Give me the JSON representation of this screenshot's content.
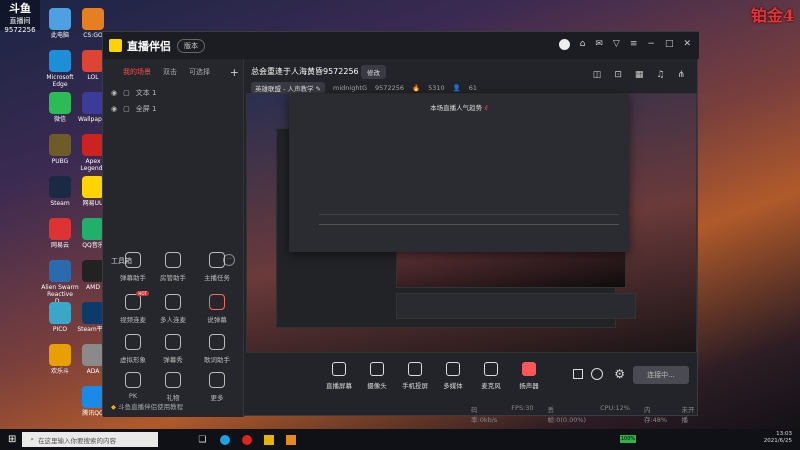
{
  "overlay": {
    "platform_logo": "斗鱼",
    "platform_sub": "直播间",
    "room_number": "9572256",
    "rank_badge": "铂金4"
  },
  "desktop": {
    "icons": [
      "此电脑",
      "Microsoft Edge",
      "微信",
      "PUBG",
      "Steam",
      "网易云",
      "Alien Swarm Reactive D...",
      "PICO",
      "欢乐斗",
      "CS:GO",
      "LOL",
      "Wallpaper",
      "Apex Legends",
      "网易UU",
      "QQ音乐",
      "AMD",
      "Steam平台",
      "ADA",
      "腾讯QQ"
    ]
  },
  "window": {
    "app_name": "直播伴侣",
    "app_tag": "版本",
    "left_tabs": [
      "我的场景",
      "双击",
      "可选择"
    ],
    "layers": [
      "文本 1",
      "全屏 1"
    ],
    "tools_header": "工具箱",
    "tools": [
      "弹幕助手",
      "房管助手",
      "主播任务",
      "视频连麦",
      "多人连麦",
      "说弹幕",
      "虚拟形象",
      "弹幕秀",
      "歌词助手",
      "PK",
      "礼物",
      "更多"
    ],
    "hot_tag": "HOT",
    "footer_tip": "斗鱼直播伴侣使用教程",
    "room_title": "总会重逢于人海黄昏9572256",
    "edit_label": "修改",
    "category": "英雄联盟 - 人声教学 ✎",
    "anchor": "midnightG",
    "room_id": "9572256",
    "fans": "5310",
    "online": "61",
    "popup_title": "本场直播人气趋势",
    "bottom_tools": [
      "直播屏幕",
      "摄像头",
      "手机投屏",
      "多媒体",
      "麦克风",
      "扬声器"
    ],
    "start_label": "连接中...",
    "stats": [
      "码率:0kb/s",
      "FPS:30",
      "丢帧:0(0.00%)",
      "CPU:12%",
      "内存:48%",
      "未开播"
    ]
  },
  "taskbar": {
    "search_placeholder": "在这里输入你要搜索的内容",
    "time": "13:03",
    "date": "2021/6/25",
    "battery": "100%"
  }
}
